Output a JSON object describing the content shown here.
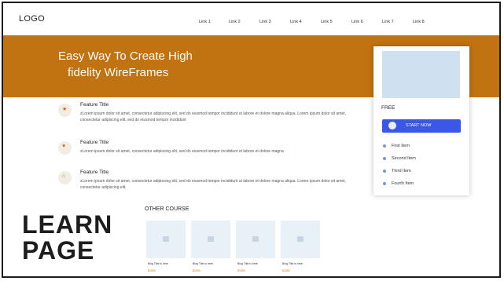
{
  "nav": {
    "logo": "LOGO",
    "links": [
      "Link 1",
      "Link 2",
      "Link 3",
      "Link 4",
      "Link 5",
      "Link 6",
      "Link 7",
      "Link 8"
    ]
  },
  "hero": {
    "title_line1": "Easy Way To Create High",
    "title_line2": "fidelity WireFrames"
  },
  "features": [
    {
      "icon": "star-icon",
      "title": "Feature Title",
      "text": "zLorem ipsum dolor sit amet, consectetur adipiscing elit, sed do eiusmod tempor incididunt ut labore et dolore magna aliqua. Lorem ipsum dolor sit amet, consectetur adipiscing elit, sed do eiusmod tempor incididunt"
    },
    {
      "icon": "heart-icon",
      "title": "Feature Title",
      "text": "zLorem ipsum dolor sit amet, consectetur adipiscing elit, sed do eiusmod tempor incididunt ut labore et dolore magna"
    },
    {
      "icon": "home-icon",
      "title": "Feature Title",
      "text": "zLorem ipsum dolor sit amet, consectetur adipiscing elit, sed do eiusmod tempor incididunt ut labore et dolore magna aliqua. Lorem ipsum dolor sit amet, consectetur adipiscing elit,"
    }
  ],
  "sidebar": {
    "free_label": "FREE",
    "start_button": "START NOW",
    "items": [
      "First Item",
      "Second Item",
      "Third Item",
      "Fourth Item"
    ]
  },
  "learn": {
    "line1": "LEARN",
    "line2": "PAGE"
  },
  "other_course": {
    "heading": "OTHER COURSE",
    "cards": [
      {
        "title": "Blog Title is here",
        "price": "$1900"
      },
      {
        "title": "Blog Title is here",
        "price": "$1900"
      },
      {
        "title": "Blog Title is here",
        "price": "$1900"
      },
      {
        "title": "Blog Title is here",
        "price": "$1900"
      }
    ]
  },
  "colors": {
    "accent": "#c17211",
    "button": "#3a57e8",
    "placeholder": "#cfe0f1"
  }
}
